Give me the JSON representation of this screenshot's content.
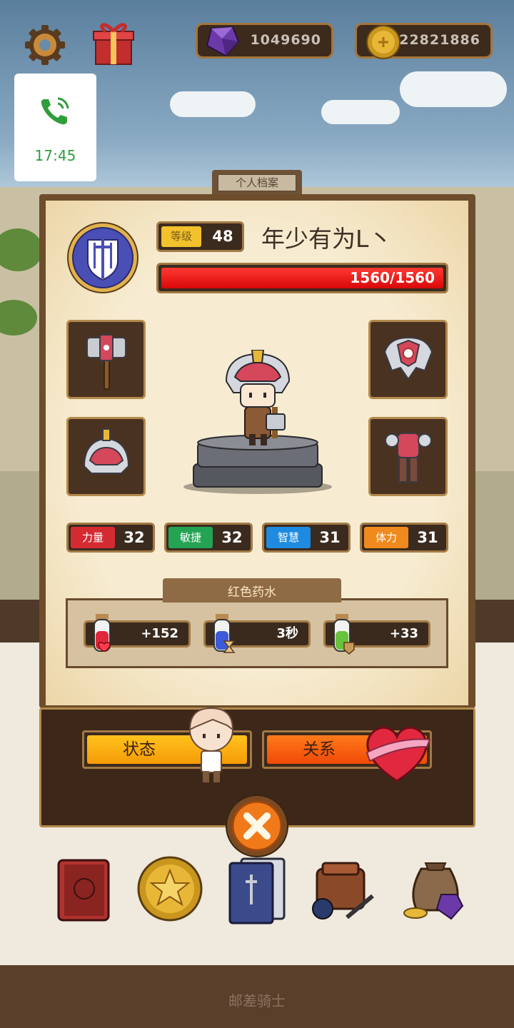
{
  "hud": {
    "gems": "1049690",
    "coins": "122821886",
    "icons": [
      "gear-icon",
      "gift-icon",
      "gem-icon",
      "coin-icon"
    ]
  },
  "call_overlay": {
    "time": "17:45",
    "icon": "phone-icon"
  },
  "profile": {
    "tab_title": "个人档案",
    "level_label": "等级",
    "level": "48",
    "player_name": "年少有为L丶",
    "hp_text": "1560/1560",
    "hp_fraction": 1.0
  },
  "equipment": [
    "hammer-icon",
    "shoulder-armor-icon",
    "helmet-icon",
    "body-armor-icon"
  ],
  "stats": [
    {
      "label": "力量",
      "value": "32",
      "color": "#d42b33"
    },
    {
      "label": "敏捷",
      "value": "32",
      "color": "#23a353"
    },
    {
      "label": "智慧",
      "value": "31",
      "color": "#1f8be0"
    },
    {
      "label": "体力",
      "value": "31",
      "color": "#f08a1e"
    }
  ],
  "potions": {
    "title": "红色药水",
    "items": [
      {
        "value": "+152",
        "color": "#e0283a"
      },
      {
        "value": "3秒",
        "color": "#3d5bd8"
      },
      {
        "value": "+33",
        "color": "#68c23a"
      }
    ]
  },
  "actions": {
    "status_label": "状态",
    "relation_label": "关系"
  },
  "bottom_nav": [
    "journal-icon",
    "star-coin-icon",
    "cards-icon",
    "bag-icon",
    "treasure-sack-icon"
  ],
  "footer": "邮差骑士"
}
